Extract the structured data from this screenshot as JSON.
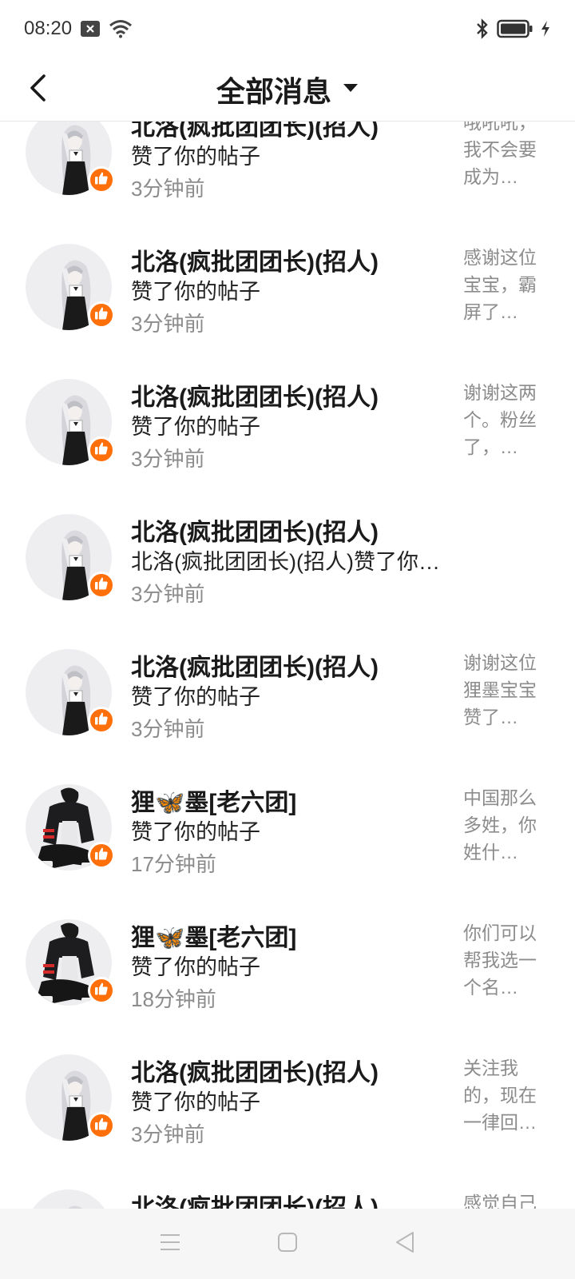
{
  "status_bar": {
    "time": "08:20",
    "icons": [
      "notification-x-icon",
      "wifi-icon",
      "bluetooth-icon",
      "battery-icon",
      "charging-icon"
    ]
  },
  "header": {
    "title": "全部消息",
    "back_icon": "chevron-left-icon",
    "dropdown_icon": "caret-down-icon"
  },
  "messages": [
    {
      "name": "北洛(疯批团团长)(招人)",
      "action": "赞了你的帖子",
      "time": "3分钟前",
      "preview": "哦吼吼，我不会要成为…",
      "avatar": "white-hair-girl"
    },
    {
      "name": "北洛(疯批团团长)(招人)",
      "action": "赞了你的帖子",
      "time": "3分钟前",
      "preview": "感谢这位宝宝，霸屏了…",
      "avatar": "white-hair-girl"
    },
    {
      "name": "北洛(疯批团团长)(招人)",
      "action": "赞了你的帖子",
      "time": "3分钟前",
      "preview": "谢谢这两个。粉丝了，…",
      "avatar": "white-hair-girl"
    },
    {
      "name": "北洛(疯批团团长)(招人)",
      "action": "北洛(疯批团团长)(招人)赞了你…",
      "time": "3分钟前",
      "preview": "",
      "avatar": "white-hair-girl"
    },
    {
      "name": "北洛(疯批团团长)(招人)",
      "action": "赞了你的帖子",
      "time": "3分钟前",
      "preview": "谢谢这位狸墨宝宝赞了…",
      "avatar": "white-hair-girl"
    },
    {
      "name": "狸🦋墨[老六团]",
      "action": "赞了你的帖子",
      "time": "17分钟前",
      "preview": "中国那么多姓，你姓什…",
      "avatar": "dark-jacket-boy"
    },
    {
      "name": "狸🦋墨[老六团]",
      "action": "赞了你的帖子",
      "time": "18分钟前",
      "preview": "你们可以帮我选一个名…",
      "avatar": "dark-jacket-boy"
    },
    {
      "name": "北洛(疯批团团长)(招人)",
      "action": "赞了你的帖子",
      "time": "3分钟前",
      "preview": "关注我的，现在一律回…",
      "avatar": "white-hair-girl"
    },
    {
      "name": "北洛(疯批团团长)(招人)",
      "action": "",
      "time": "",
      "preview": "感觉自己",
      "avatar": "white-hair-girl"
    }
  ],
  "nav_bar": {
    "buttons": [
      "menu-icon",
      "home-square-icon",
      "back-triangle-icon"
    ]
  },
  "colors": {
    "accent": "#ff6f0a",
    "muted_text": "#8c8c8c",
    "avatar_bg": "#eeeef1"
  }
}
